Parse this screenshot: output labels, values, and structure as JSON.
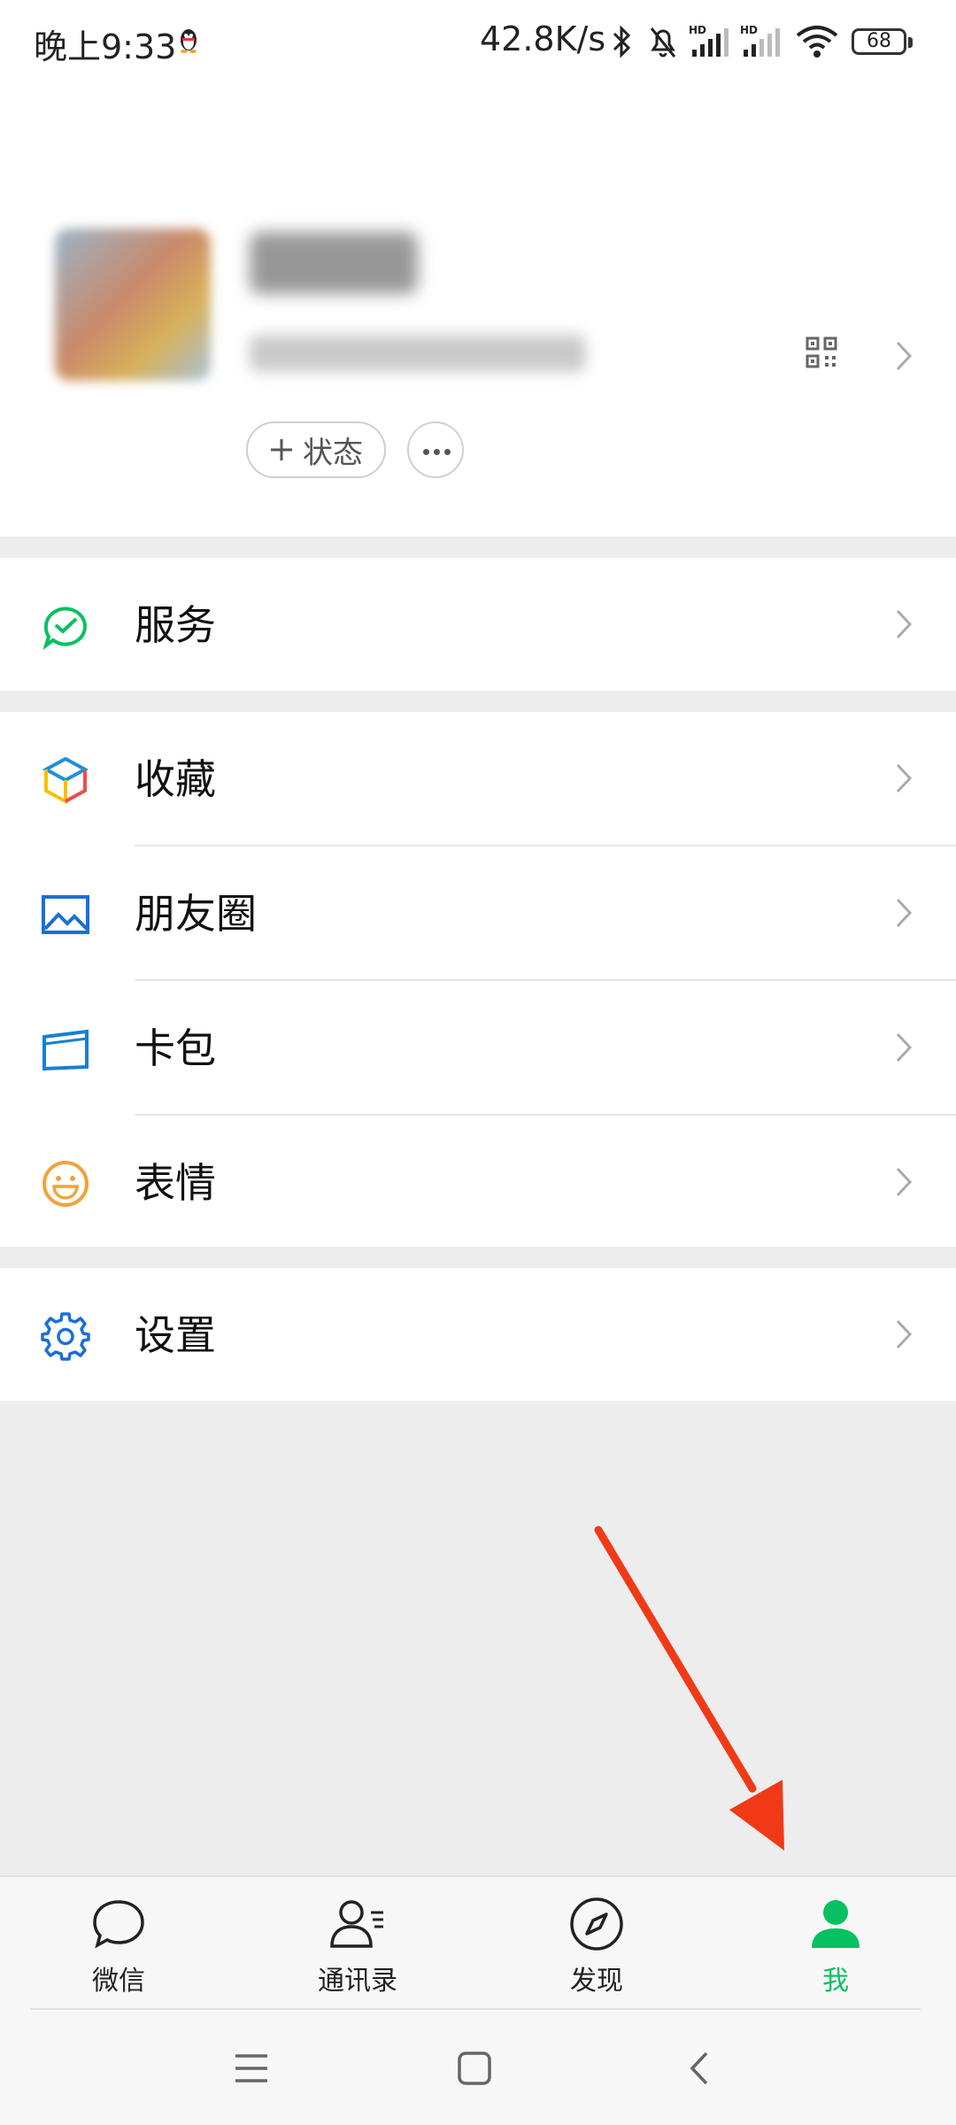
{
  "status_bar": {
    "time": "晚上9:33",
    "network_speed": "42.8K/s",
    "battery": "68",
    "icons": [
      "qq-penguin-icon",
      "bluetooth-icon",
      "mute-bell-icon",
      "hd-signal-icon",
      "hd-signal-icon",
      "wifi-icon",
      "battery-icon"
    ]
  },
  "profile": {
    "status_button_label": "状态",
    "qr_icon": "qr-code-icon",
    "more_icon": "more-dots-icon"
  },
  "menu_groups": [
    {
      "items": [
        {
          "label": "服务",
          "icon": "service-check-icon",
          "icon_color": "#07c160"
        }
      ]
    },
    {
      "items": [
        {
          "label": "收藏",
          "icon": "favorites-cube-icon",
          "icon_color": "#1f8fd8"
        },
        {
          "label": "朋友圈",
          "icon": "moments-picture-icon",
          "icon_color": "#1a6fd6"
        },
        {
          "label": "卡包",
          "icon": "card-wallet-icon",
          "icon_color": "#1a7fd0"
        },
        {
          "label": "表情",
          "icon": "sticker-smile-icon",
          "icon_color": "#f0a33a"
        }
      ]
    },
    {
      "items": [
        {
          "label": "设置",
          "icon": "settings-gear-icon",
          "icon_color": "#1a6fd6"
        }
      ]
    }
  ],
  "bottom_tabs": [
    {
      "label": "微信",
      "icon": "chat-bubble-icon",
      "active": false
    },
    {
      "label": "通讯录",
      "icon": "contacts-icon",
      "active": false
    },
    {
      "label": "发现",
      "icon": "discover-compass-icon",
      "active": false
    },
    {
      "label": "我",
      "icon": "me-person-icon",
      "active": true
    }
  ],
  "colors": {
    "accent": "#07c160",
    "annotation_arrow": "#f03a17",
    "background": "#ededed"
  }
}
